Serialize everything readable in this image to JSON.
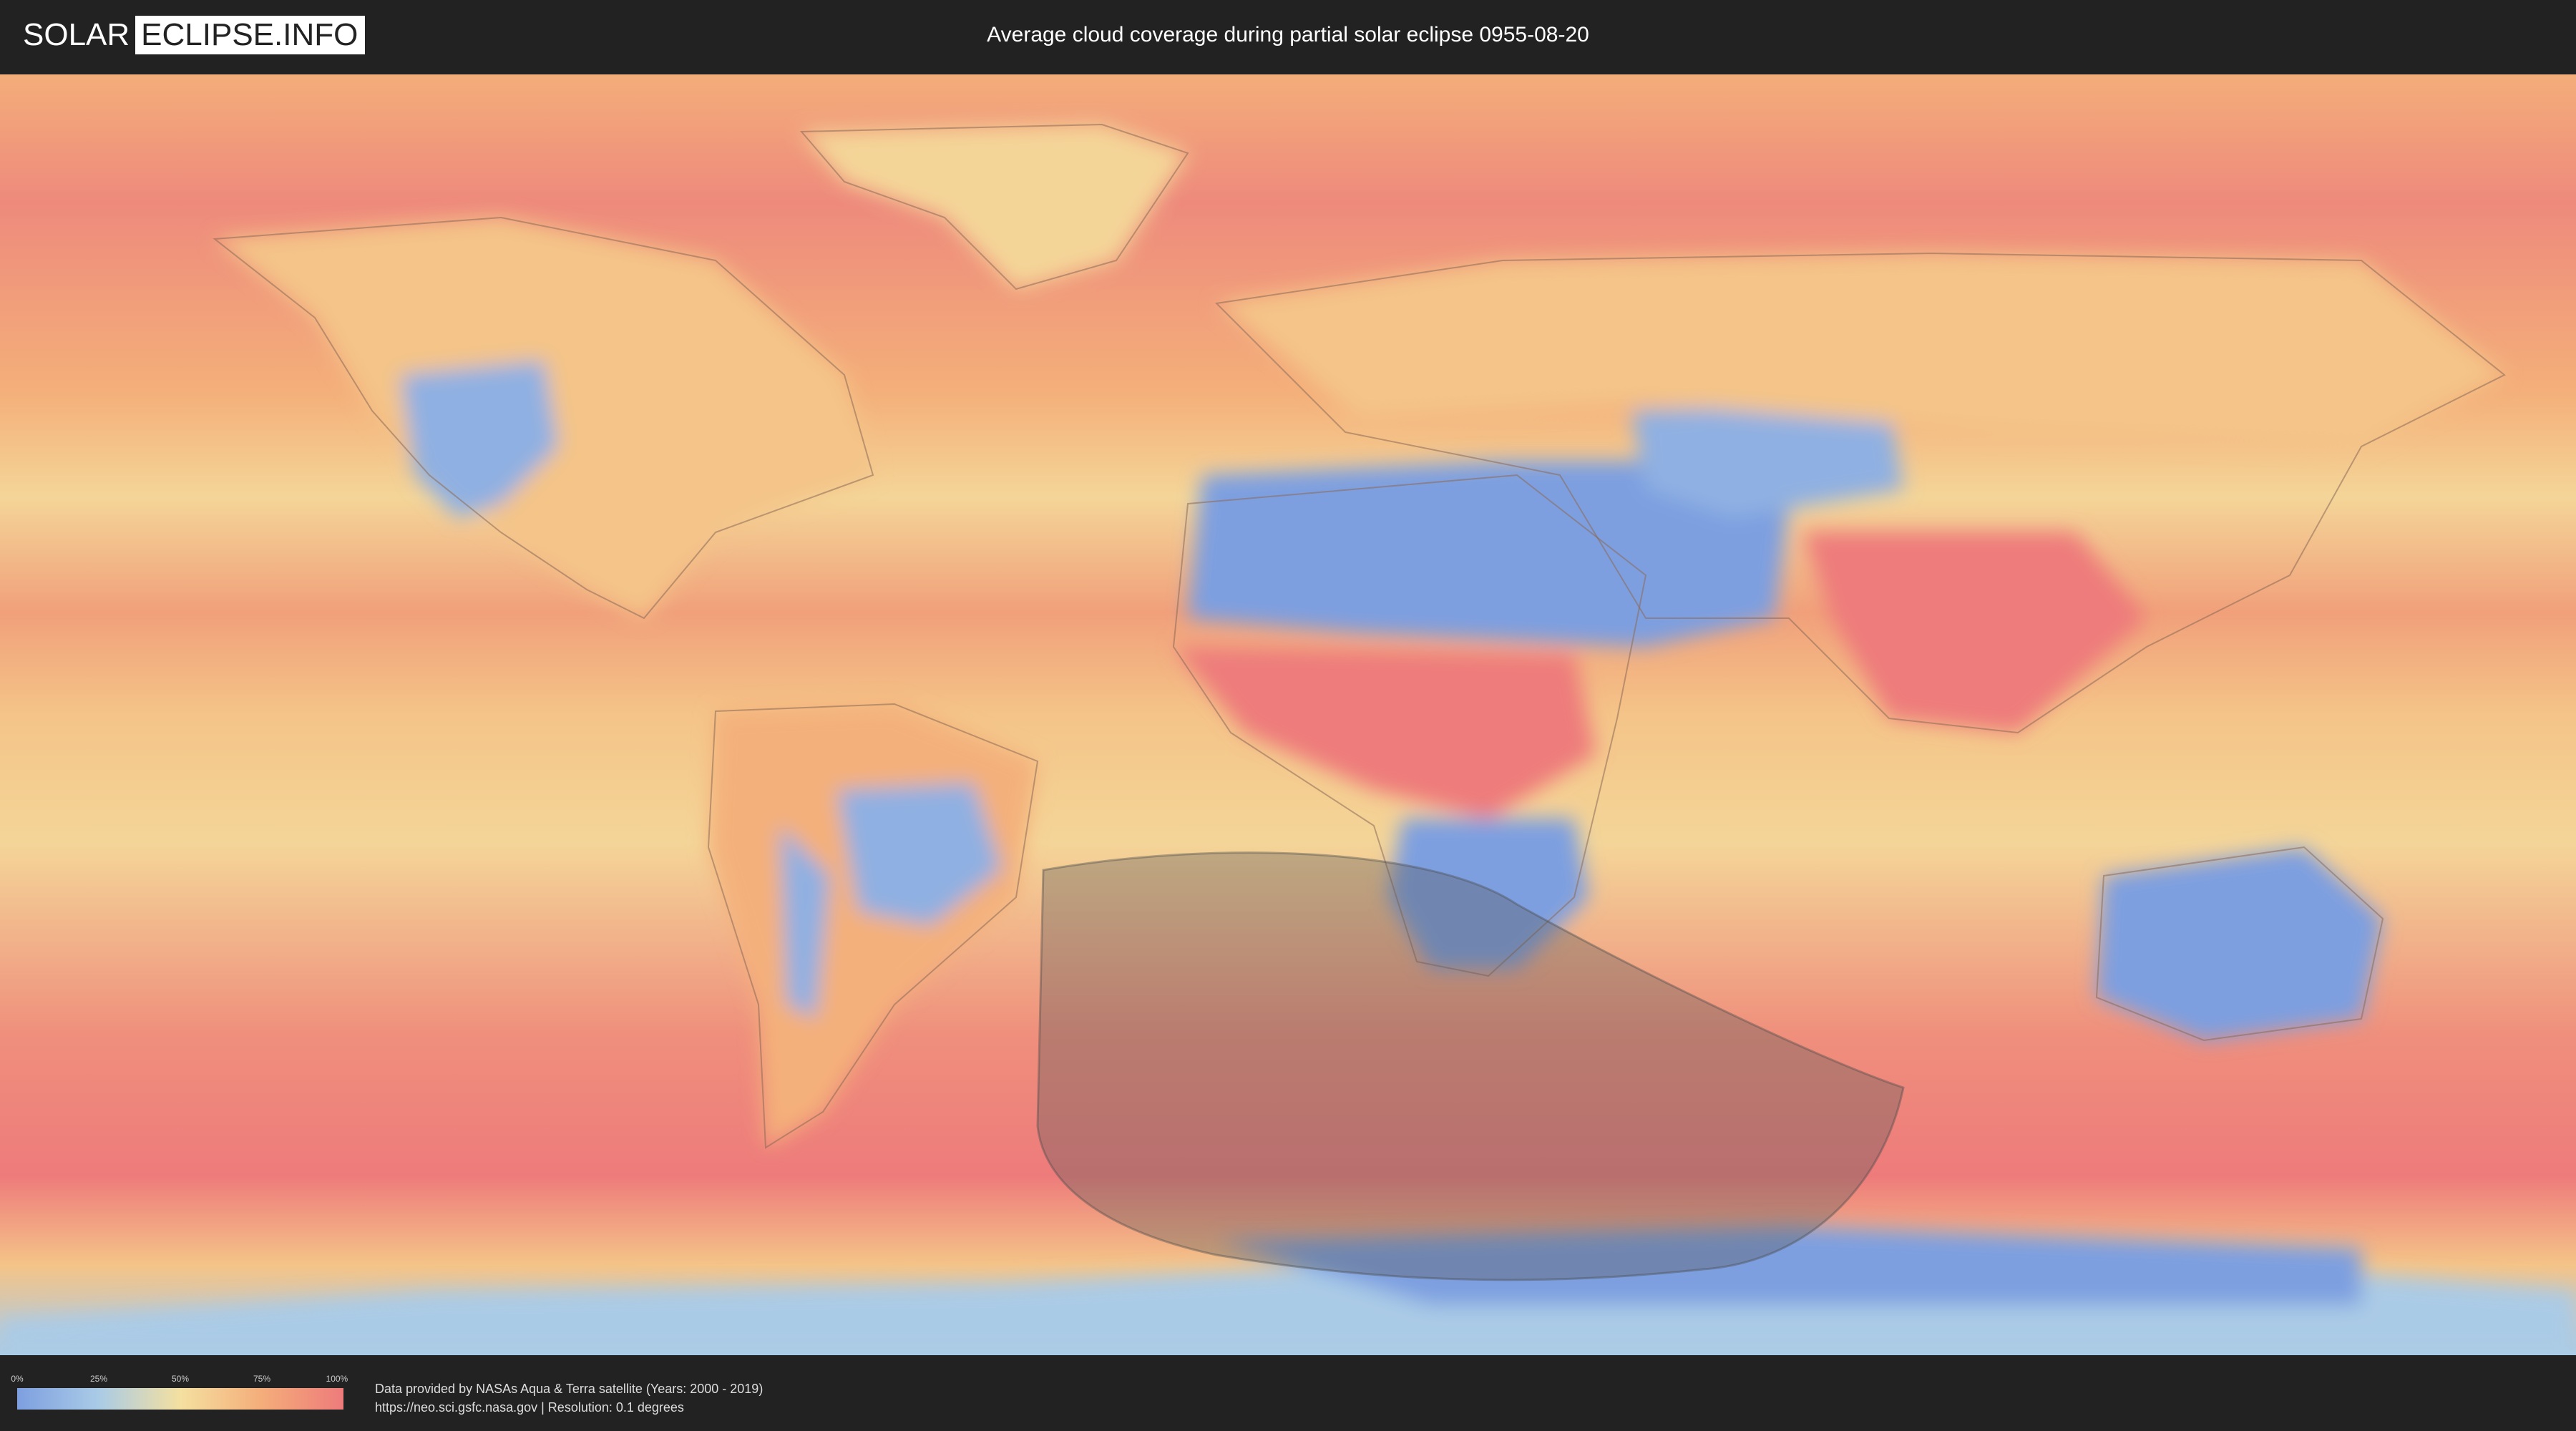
{
  "header": {
    "logo_part1": "SOLAR",
    "logo_part2": "ECLIPSE.INFO",
    "title": "Average cloud coverage during partial solar eclipse 0955-08-20"
  },
  "map": {
    "eclipse_shadow_color": "#5a5a5a",
    "colors": {
      "clear": "#7d9fe0",
      "low": "#aacbe6",
      "mid": "#f4e0a0",
      "high": "#f4ad7a",
      "overcast": "#ee7b7b"
    }
  },
  "legend": {
    "ticks": [
      "0%",
      "25%",
      "50%",
      "75%",
      "100%"
    ]
  },
  "credits": {
    "line1": "Data provided by NASAs Aqua & Terra satellite (Years: 2000 - 2019)",
    "line2": "https://neo.sci.gsfc.nasa.gov | Resolution: 0.1 degrees"
  }
}
